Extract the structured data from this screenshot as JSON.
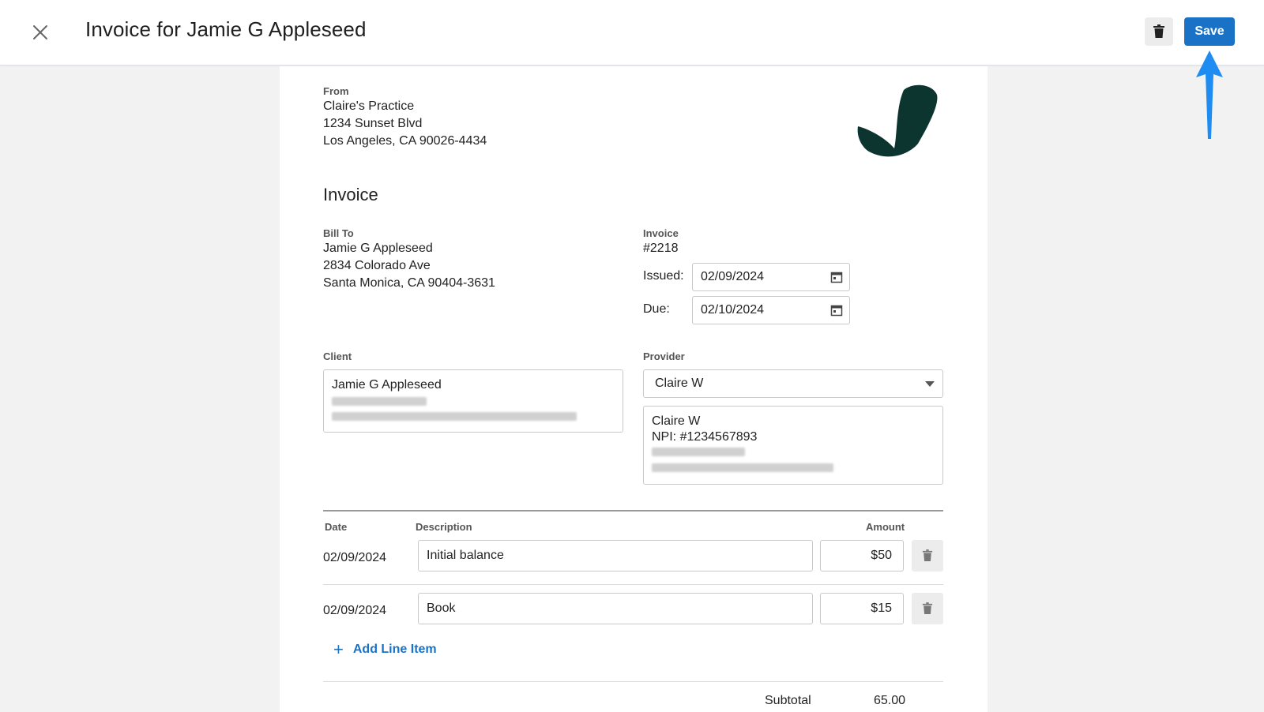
{
  "header": {
    "title": "Invoice for Jamie G Appleseed",
    "save_label": "Save"
  },
  "from": {
    "label": "From",
    "name": "Claire's Practice",
    "address1": "1234 Sunset Blvd",
    "address2": "Los Angeles, CA 90026-4434"
  },
  "invoice_heading": "Invoice",
  "bill_to": {
    "label": "Bill To",
    "name": "Jamie G Appleseed",
    "address1": "2834 Colorado Ave",
    "address2": "Santa Monica, CA 90404-3631"
  },
  "invoice_meta": {
    "label": "Invoice",
    "number": "#2218",
    "issued_label": "Issued:",
    "issued_value": "02/09/2024",
    "due_label": "Due:",
    "due_value": "02/10/2024"
  },
  "client": {
    "label": "Client",
    "name": "Jamie G Appleseed"
  },
  "provider": {
    "label": "Provider",
    "selected": "Claire W",
    "card_name": "Claire W",
    "card_npi": "NPI: #1234567893"
  },
  "table": {
    "headers": {
      "date": "Date",
      "description": "Description",
      "amount": "Amount"
    },
    "rows": [
      {
        "date": "02/09/2024",
        "description": "Initial balance",
        "amount": "$50"
      },
      {
        "date": "02/09/2024",
        "description": "Book",
        "amount": "$15"
      }
    ]
  },
  "add_line_label": "Add Line Item",
  "totals": {
    "subtotal_label": "Subtotal",
    "subtotal_value": "65.00"
  },
  "colors": {
    "accent": "#1a72c6",
    "logo": "#0d3530",
    "arrow": "#1e8cf0"
  },
  "icons": [
    "close-icon",
    "trash-icon",
    "calendar-icon",
    "chevron-down-icon",
    "plus-icon"
  ]
}
